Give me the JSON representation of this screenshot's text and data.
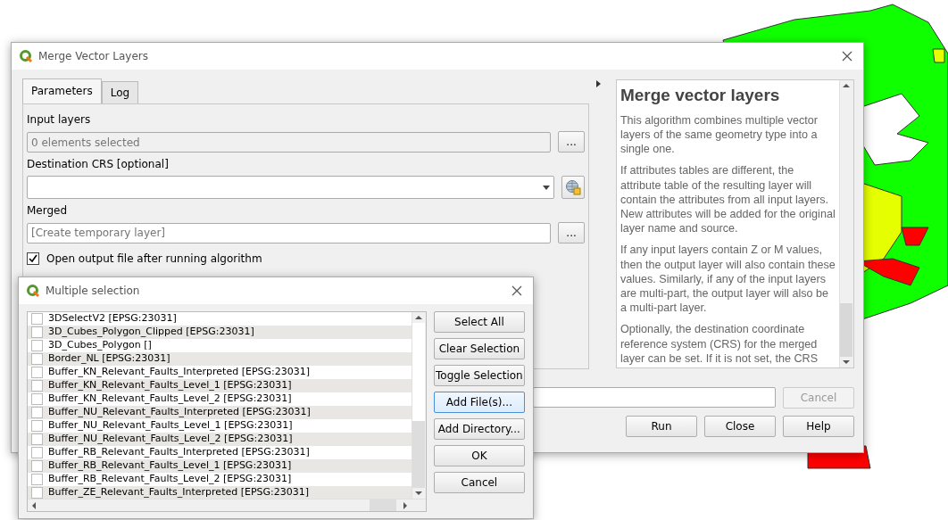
{
  "main_dialog": {
    "title": "Merge Vector Layers",
    "tabs": [
      {
        "label": "Parameters",
        "selected": true
      },
      {
        "label": "Log",
        "selected": false
      }
    ],
    "parameters": [
      {
        "kind": "multi",
        "label": "Input layers",
        "value": "0 elements selected",
        "button": "..."
      },
      {
        "kind": "crs",
        "label": "Destination CRS [optional]"
      },
      {
        "kind": "output",
        "label": "Merged",
        "placeholder": "[Create temporary layer]",
        "button": "..."
      }
    ],
    "open_output": {
      "label": "Open output file after running algorithm",
      "checked": true
    },
    "help": {
      "title": "Merge vector layers",
      "paragraphs": [
        "This algorithm combines multiple vector layers of the same geometry type into a single one.",
        "If attributes tables are different, the attribute table of the resulting layer will contain the attributes from all input layers. New attributes will be added for the original layer name and source.",
        "If any input layers contain Z or M values, then the output layer will also contain these values. Similarly, if any of the input layers are multi-part, the output layer will also be a multi-part layer.",
        "Optionally, the destination coordinate reference system (CRS) for the merged layer can be set. If it is not set, the CRS"
      ]
    },
    "buttons": [
      {
        "label": "Cancel",
        "disabled": true
      },
      {
        "label": "Run",
        "disabled": false
      },
      {
        "label": "Close",
        "disabled": false
      },
      {
        "label": "Help",
        "disabled": false
      }
    ]
  },
  "selection_dialog": {
    "title": "Multiple selection",
    "items": [
      {
        "label": "3DSelectV2 [EPSG:23031]",
        "checked": false
      },
      {
        "label": "3D_Cubes_Polygon_Clipped [EPSG:23031]",
        "checked": false
      },
      {
        "label": "3D_Cubes_Polygon []",
        "checked": false
      },
      {
        "label": "Border_NL [EPSG:23031]",
        "checked": false
      },
      {
        "label": "Buffer_KN_Relevant_Faults_Interpreted [EPSG:23031]",
        "checked": false
      },
      {
        "label": "Buffer_KN_Relevant_Faults_Level_1 [EPSG:23031]",
        "checked": false
      },
      {
        "label": "Buffer_KN_Relevant_Faults_Level_2 [EPSG:23031]",
        "checked": false
      },
      {
        "label": "Buffer_NU_Relevant_Faults_Interpreted [EPSG:23031]",
        "checked": false
      },
      {
        "label": "Buffer_NU_Relevant_Faults_Level_1 [EPSG:23031]",
        "checked": false
      },
      {
        "label": "Buffer_NU_Relevant_Faults_Level_2 [EPSG:23031]",
        "checked": false
      },
      {
        "label": "Buffer_RB_Relevant_Faults_Interpreted [EPSG:23031]",
        "checked": false
      },
      {
        "label": "Buffer_RB_Relevant_Faults_Level_1 [EPSG:23031]",
        "checked": false
      },
      {
        "label": "Buffer_RB_Relevant_Faults_Level_2 [EPSG:23031]",
        "checked": false
      },
      {
        "label": "Buffer_ZE_Relevant_Faults_Interpreted [EPSG:23031]",
        "checked": false
      }
    ],
    "buttons": [
      {
        "label": "Select All",
        "focused": false
      },
      {
        "label": "Clear Selection",
        "focused": false
      },
      {
        "label": "Toggle Selection",
        "focused": false
      },
      {
        "label": "Add File(s)...",
        "focused": true
      },
      {
        "label": "Add Directory...",
        "focused": false
      },
      {
        "label": "OK",
        "focused": false
      },
      {
        "label": "Cancel",
        "focused": false
      }
    ]
  }
}
